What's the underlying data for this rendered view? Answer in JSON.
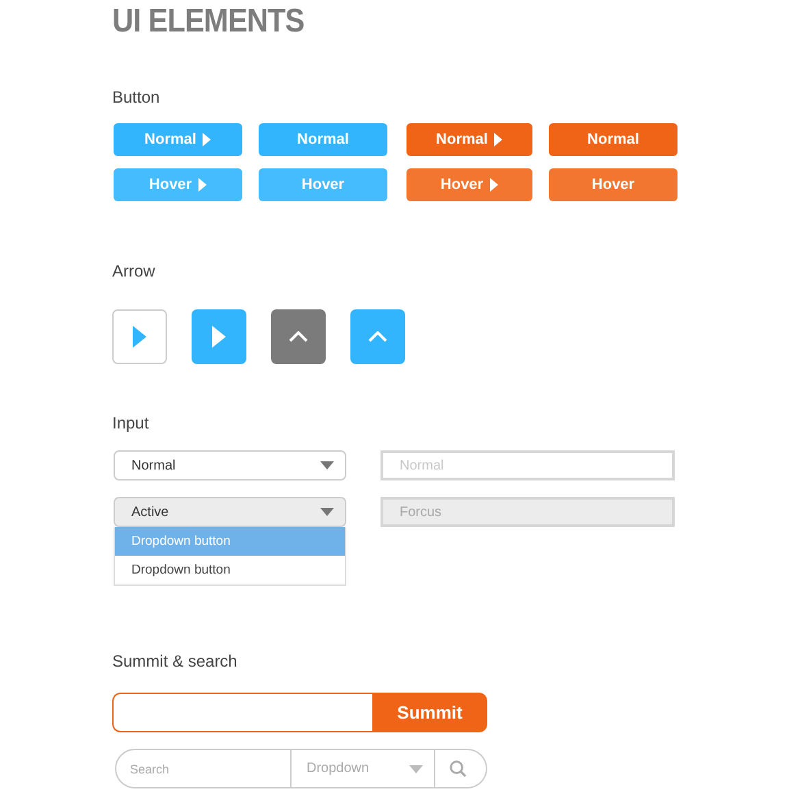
{
  "title": "UI ELEMENTS",
  "button_section": {
    "label": "Button",
    "buttons": [
      {
        "text": "Normal",
        "color": "#33b5fe",
        "arrow": true
      },
      {
        "text": "Normal",
        "color": "#33b5fe",
        "arrow": false
      },
      {
        "text": "Normal",
        "color": "#f06418",
        "arrow": true
      },
      {
        "text": "Normal",
        "color": "#f06418",
        "arrow": false
      },
      {
        "text": "Hover",
        "color": "#45bcfe",
        "arrow": true
      },
      {
        "text": "Hover",
        "color": "#45bcfe",
        "arrow": false
      },
      {
        "text": "Hover",
        "color": "#f27530",
        "arrow": true
      },
      {
        "text": "Hover",
        "color": "#f27530",
        "arrow": false
      }
    ]
  },
  "arrow_section": {
    "label": "Arrow",
    "arrows": [
      {
        "kind": "outline-play",
        "color": "#33b5fe"
      },
      {
        "kind": "play",
        "color": "#33b5fe"
      },
      {
        "kind": "chevron",
        "color": "#7b7b7b"
      },
      {
        "kind": "chevron",
        "color": "#33b5fe"
      }
    ]
  },
  "input_section": {
    "label": "Input",
    "rows": [
      {
        "dropdown": {
          "value": "Normal",
          "active": false
        },
        "field": {
          "placeholder": "Normal",
          "focused": false
        }
      },
      {
        "dropdown": {
          "value": "Active",
          "active": true,
          "options": [
            {
              "text": "Dropdown button",
              "selected": true
            },
            {
              "text": "Dropdown button",
              "selected": false
            }
          ]
        },
        "field": {
          "placeholder": "Forcus",
          "focused": true
        }
      }
    ]
  },
  "submit_section": {
    "label": "Summit & search",
    "submit_button": "Summit",
    "search": {
      "placeholder": "Search",
      "dropdown": "Dropdown"
    }
  }
}
